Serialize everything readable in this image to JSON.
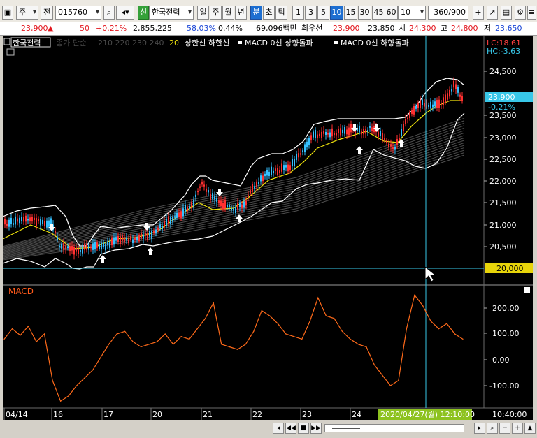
{
  "toolbar": {
    "market_label": "주",
    "type_label": "전",
    "stock_code": "015760",
    "new_badge": "신",
    "stock_name": "한국전력",
    "periods": [
      "일",
      "주",
      "월",
      "년",
      "분",
      "초",
      "틱"
    ],
    "active_period": "분",
    "intervals": [
      "1",
      "3",
      "5",
      "10",
      "15",
      "30",
      "45",
      "60"
    ],
    "active_interval": "10",
    "interval_value": "10",
    "count_value": "360",
    "count_total": "/900"
  },
  "infobar": {
    "price": "23,900",
    "change": "50",
    "change_pct": "+0.21%",
    "volume": "2,855,225",
    "volume_ratio": "58.03%",
    "turnover": "0.44%",
    "amount": "69,096백만",
    "best_label": "최우선",
    "best_ask": "23,900",
    "best_bid": "23,850",
    "open_label": "시",
    "open": "24,300",
    "high_label": "고",
    "high": "24,800",
    "low_label": "저",
    "low": "23,650"
  },
  "legend": {
    "name": "한국전력",
    "ma_title": "종가 단순",
    "ma_periods": "210  220  230  240",
    "ma_last": "20",
    "bands": "상한선 하한선",
    "macd_up": "MACD 0선 상향돌파",
    "macd_down": "MACD 0선 하향돌파"
  },
  "price_panel": {
    "lc": "LC:18.61",
    "hc": "HC:-3.63",
    "current_price": "23,900",
    "current_change": "-0.21%",
    "cursor_price": "20,000",
    "y_ticks": [
      "24,500",
      "24,000",
      "23,500",
      "23,000",
      "22,500",
      "22,000",
      "21,500",
      "21,000",
      "20,500"
    ]
  },
  "macd_panel": {
    "title": "MACD",
    "y_ticks": [
      "200.00",
      "100.00",
      "0.00",
      "-100.00"
    ]
  },
  "x_axis": {
    "labels": [
      "04/14",
      "16",
      "17",
      "20",
      "21",
      "22",
      "23",
      "24"
    ],
    "cursor_time": "2020/04/27(월) 12:10:00",
    "right_time": "10:40:00"
  },
  "colors": {
    "background": "#000000",
    "candle_up": "#ff3030",
    "candle_down": "#35c0ff",
    "macd_line": "#ff6a1a",
    "band_line": "#ffffff",
    "ma_line": "#f2e60c",
    "crosshair": "#38c7e8",
    "price_tag": "#38c7e8",
    "cursor_tag": "#e7d40a"
  },
  "chart_data": {
    "type": "line",
    "series": [
      {
        "name": "MACD",
        "x": [
          0,
          3,
          6,
          9,
          12,
          15,
          18,
          21,
          24,
          27,
          30,
          33,
          36,
          39,
          42,
          45,
          48,
          51,
          54,
          57,
          60,
          63,
          66,
          69,
          72,
          75,
          78,
          81,
          84,
          87,
          90,
          93,
          96,
          99,
          102,
          105,
          108,
          111,
          114,
          117,
          120,
          123,
          126,
          129,
          132,
          135,
          138,
          141,
          144,
          147,
          150,
          153,
          156,
          159,
          162,
          165,
          168,
          171
        ],
        "values": [
          80,
          120,
          95,
          130,
          70,
          100,
          -80,
          -160,
          -140,
          -100,
          -70,
          -40,
          10,
          60,
          100,
          110,
          70,
          50,
          60,
          70,
          100,
          60,
          90,
          80,
          120,
          160,
          220,
          60,
          50,
          40,
          60,
          110,
          190,
          170,
          140,
          100,
          90,
          80,
          150,
          240,
          170,
          160,
          110,
          80,
          60,
          50,
          -20,
          -60,
          -100,
          -80,
          120,
          250,
          210,
          150,
          120,
          140,
          100,
          80
        ]
      }
    ],
    "ylim": [
      -150,
      270
    ]
  }
}
